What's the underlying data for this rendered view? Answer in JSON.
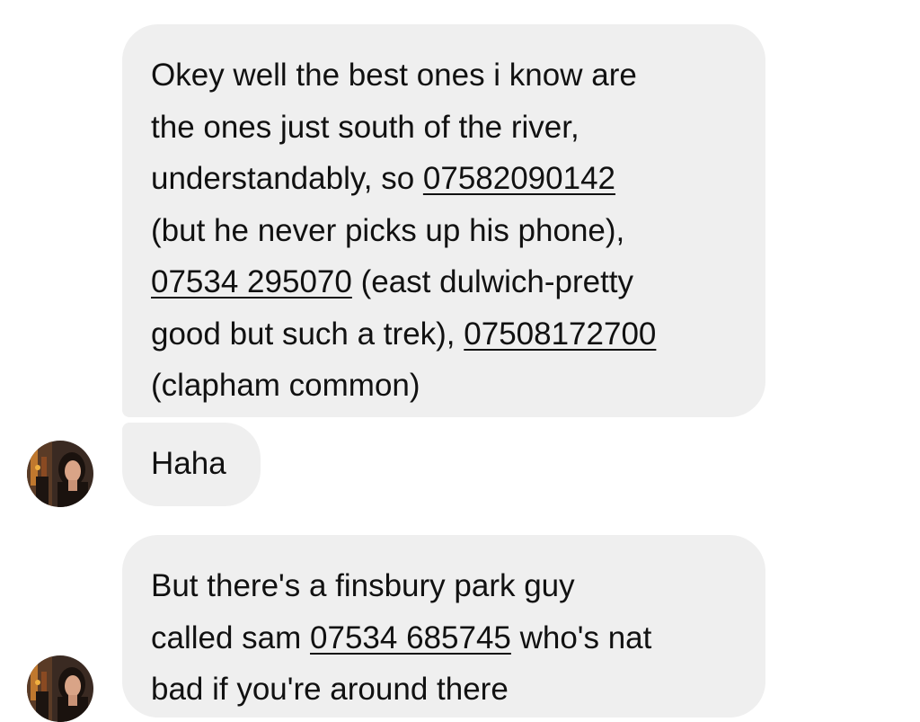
{
  "messages": [
    {
      "lines": [
        {
          "parts": [
            {
              "text": "Okey well the best ones i know are"
            }
          ]
        },
        {
          "parts": [
            {
              "text": "the ones just south of the river,"
            }
          ]
        },
        {
          "parts": [
            {
              "text": "understandably, so "
            },
            {
              "text": "07582090142",
              "link": true
            }
          ]
        },
        {
          "parts": [
            {
              "text": "(but he never picks up his phone),"
            }
          ]
        },
        {
          "parts": [
            {
              "text": "07534 295070",
              "link": true
            },
            {
              "text": " (east dulwich-pretty"
            }
          ]
        },
        {
          "parts": [
            {
              "text": "good but such a trek), "
            },
            {
              "text": "07508172700",
              "link": true
            }
          ]
        },
        {
          "parts": [
            {
              "text": "(clapham common)"
            }
          ]
        }
      ]
    },
    {
      "lines": [
        {
          "parts": [
            {
              "text": "Haha"
            }
          ]
        }
      ]
    },
    {
      "lines": [
        {
          "parts": [
            {
              "text": "But there's a finsbury park guy"
            }
          ]
        },
        {
          "parts": [
            {
              "text": "called sam "
            },
            {
              "text": "07534 685745",
              "link": true
            },
            {
              "text": " who's nat"
            }
          ]
        },
        {
          "parts": [
            {
              "text": "bad if you're around there"
            }
          ]
        }
      ]
    }
  ],
  "avatars": [
    {
      "icon": "contact-avatar-icon"
    },
    {
      "icon": "contact-avatar-icon"
    }
  ],
  "colors": {
    "bubble_bg": "#efefef",
    "text": "#111111",
    "page_bg": "#ffffff"
  }
}
